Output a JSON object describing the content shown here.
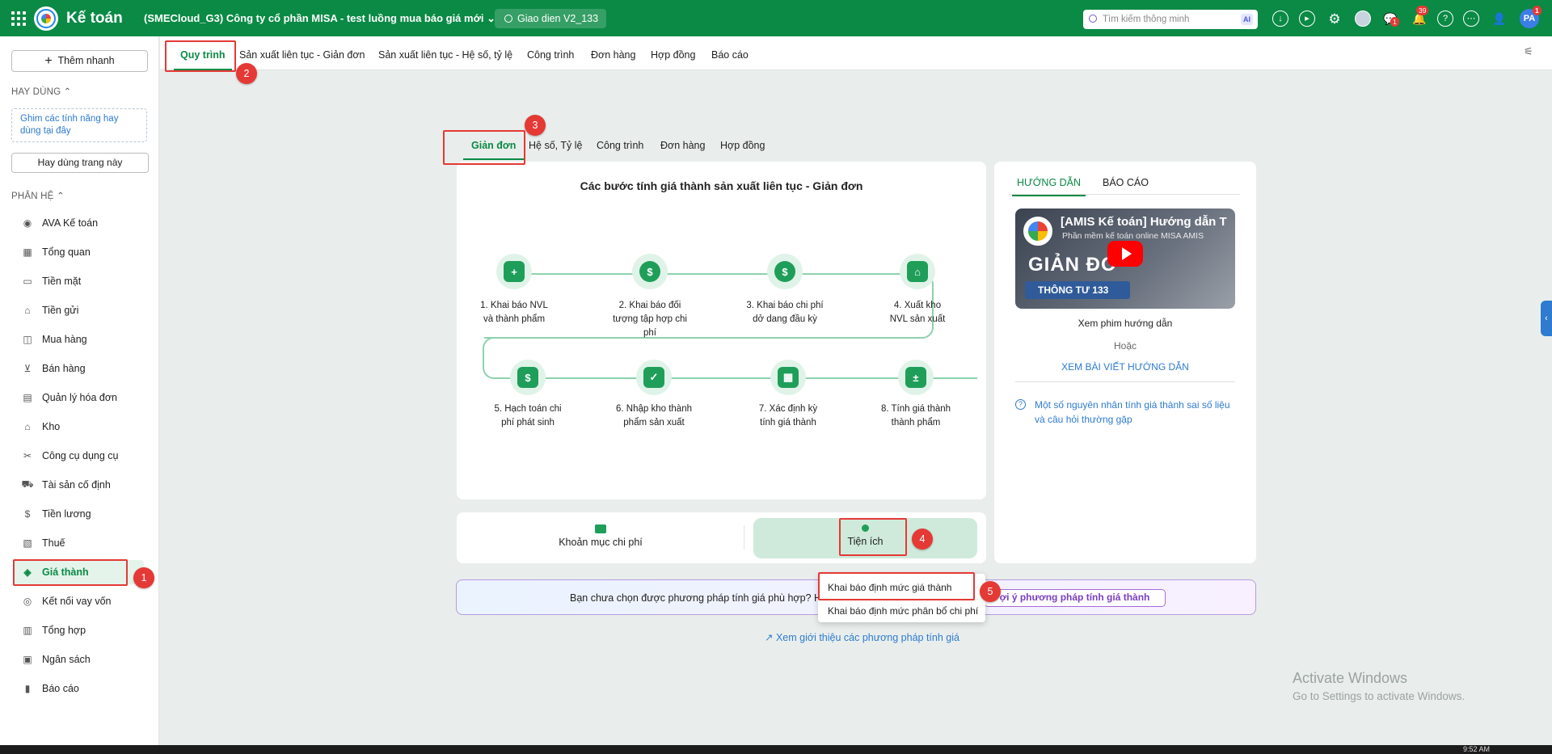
{
  "topbar": {
    "app_title": "Kế toán",
    "company": "(SMECloud_G3) Công ty cổ phần MISA - test luồng mua báo giá mới",
    "interface": "Giao dien V2_133",
    "search_placeholder": "Tìm kiếm thông minh",
    "ai_label": "AI",
    "chat_badge": "1",
    "bell_badge": "39",
    "avatar_initials": "PA",
    "avatar_badge": "1",
    "accent": "#0a8a45"
  },
  "sidebar": {
    "quick_add": "Thêm nhanh",
    "frequent_title": "HAY DÙNG",
    "pin_hint": "Ghim các tính năng hay dùng tại đây",
    "frequent_button": "Hay dùng trang này",
    "modules_title": "PHÂN HỆ",
    "items": [
      {
        "label": "AVA Kế toán",
        "icon": "ava-avatar-icon"
      },
      {
        "label": "Tổng quan",
        "icon": "dashboard-icon"
      },
      {
        "label": "Tiền mặt",
        "icon": "cash-icon"
      },
      {
        "label": "Tiền gửi",
        "icon": "bank-icon"
      },
      {
        "label": "Mua hàng",
        "icon": "shopping-bag-icon"
      },
      {
        "label": "Bán hàng",
        "icon": "cart-icon"
      },
      {
        "label": "Quản lý hóa đơn",
        "icon": "invoice-icon"
      },
      {
        "label": "Kho",
        "icon": "warehouse-icon"
      },
      {
        "label": "Công cụ dụng cụ",
        "icon": "tools-icon"
      },
      {
        "label": "Tài sản cố định",
        "icon": "car-icon"
      },
      {
        "label": "Tiền lương",
        "icon": "salary-icon"
      },
      {
        "label": "Thuế",
        "icon": "tax-icon"
      },
      {
        "label": "Giá thành",
        "icon": "tag-icon"
      },
      {
        "label": "Kết nối vay vốn",
        "icon": "loan-icon"
      },
      {
        "label": "Tổng hợp",
        "icon": "ledger-icon"
      },
      {
        "label": "Ngân sách",
        "icon": "budget-icon"
      },
      {
        "label": "Báo cáo",
        "icon": "bar-chart-icon"
      }
    ]
  },
  "main_tabs": [
    "Quy trình",
    "Sản xuất liên tục - Giản đơn",
    "Sản xuất liên tục - Hệ số, tỷ lệ",
    "Công trình",
    "Đơn hàng",
    "Hợp đồng",
    "Báo cáo"
  ],
  "method_tabs": [
    "Giản đơn",
    "Hệ số, Tỷ lệ",
    "Công trình",
    "Đơn hàng",
    "Hợp đồng"
  ],
  "steps_card": {
    "title": "Các bước tính giá thành sản xuất liên tục - Giản đơn",
    "steps": [
      {
        "line1": "1. Khai báo NVL",
        "line2": "và thành phẩm",
        "icon": "box-plus-icon"
      },
      {
        "line1": "2. Khai báo đối",
        "line2": "tượng tập hợp chi phí",
        "icon": "dollar-target-icon"
      },
      {
        "line1": "3. Khai báo chi phí",
        "line2": "dở dang đầu kỳ",
        "icon": "money-bag-icon"
      },
      {
        "line1": "4. Xuất kho",
        "line2": "NVL sản xuất",
        "icon": "warehouse-out-icon"
      },
      {
        "line1": "5. Hạch toán chi",
        "line2": "phí phát sinh",
        "icon": "accounting-icon"
      },
      {
        "line1": "6. Nhập kho thành",
        "line2": "phẩm sản xuất",
        "icon": "box-check-icon"
      },
      {
        "line1": "7. Xác định kỳ",
        "line2": "tính giá thành",
        "icon": "calendar-money-icon"
      },
      {
        "line1": "8. Tính giá thành",
        "line2": "thành phẩm",
        "icon": "calculator-icon"
      }
    ]
  },
  "bottom_card": {
    "cost_items": "Khoản mục chi phí",
    "utilities": "Tiện ích"
  },
  "dropdown": [
    "Khai báo định mức giá thành",
    "Khai báo định mức phân bổ chi phí"
  ],
  "notice": {
    "text": "Bạn chưa chọn được phương pháp tính giá phù hợp? Hãy d",
    "button": "ợi ý phương pháp tính giá thành",
    "link": "Xem giới thiệu các phương pháp tính giá"
  },
  "guide": {
    "tab_guide": "HƯỚNG DẪN",
    "tab_report": "BÁO CÁO",
    "video_title": "[AMIS Kế toán] Hướng dẫn T",
    "video_subtitle": "Phần mềm kế toán online MISA AMIS",
    "video_big": "GIẢN ĐƠ",
    "video_bar": "THÔNG TƯ 133",
    "watch": "Xem phim hướng dẫn",
    "or": "Hoặc",
    "article": "XEM BÀI VIẾT HƯỚNG DẪN",
    "help": "Một số nguyên nhân tính giá thành sai số liệu và câu hỏi thường gặp"
  },
  "annotations": [
    "1",
    "2",
    "3",
    "4",
    "5"
  ],
  "watermark": {
    "line1": "Activate Windows",
    "line2": "Go to Settings to activate Windows."
  },
  "taskbar_time": "9:52 AM"
}
